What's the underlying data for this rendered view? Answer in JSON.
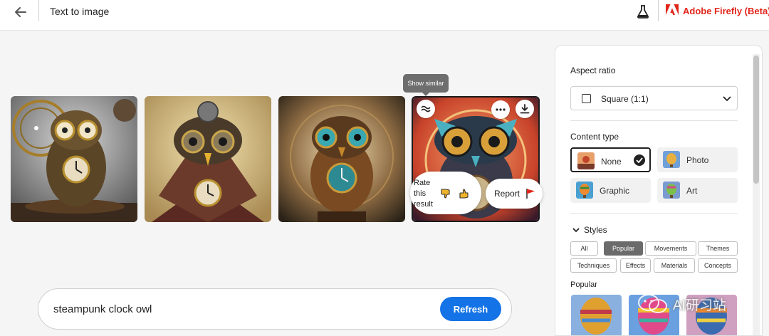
{
  "header": {
    "title": "Text to image",
    "brand": "Adobe Firefly (Beta)",
    "brand_color": "#e1251b"
  },
  "results": {
    "tooltip": "Show similar",
    "rate_label": "Rate this result",
    "report_label": "Report",
    "images": [
      {
        "subject": "steampunk clock owl"
      },
      {
        "subject": "steampunk clock owl"
      },
      {
        "subject": "steampunk clock owl"
      },
      {
        "subject": "steampunk clock owl"
      }
    ]
  },
  "prompt": {
    "value": "steampunk clock owl",
    "button": "Refresh",
    "button_color": "#1473e6"
  },
  "panel": {
    "aspect_ratio": {
      "title": "Aspect ratio",
      "value": "Square (1:1)"
    },
    "content_type": {
      "title": "Content type",
      "options": [
        {
          "label": "None",
          "selected": true
        },
        {
          "label": "Photo",
          "selected": false
        },
        {
          "label": "Graphic",
          "selected": false
        },
        {
          "label": "Art",
          "selected": false
        }
      ]
    },
    "styles": {
      "title": "Styles",
      "chips": [
        {
          "label": "All",
          "active": false
        },
        {
          "label": "Popular",
          "active": true
        },
        {
          "label": "Movements",
          "active": false
        },
        {
          "label": "Themes",
          "active": false
        },
        {
          "label": "Techniques",
          "active": false
        },
        {
          "label": "Effects",
          "active": false
        },
        {
          "label": "Materials",
          "active": false
        },
        {
          "label": "Concepts",
          "active": false
        }
      ],
      "popular_title": "Popular"
    }
  },
  "watermark": "AI研习站",
  "icons": [
    "back-arrow-icon",
    "flask-icon",
    "adobe-logo-icon",
    "show-similar-icon",
    "more-icon",
    "download-icon",
    "thumbs-down-icon",
    "thumbs-up-icon",
    "flag-icon",
    "chevron-down-icon",
    "checkmark-icon",
    "wechat-icon"
  ]
}
